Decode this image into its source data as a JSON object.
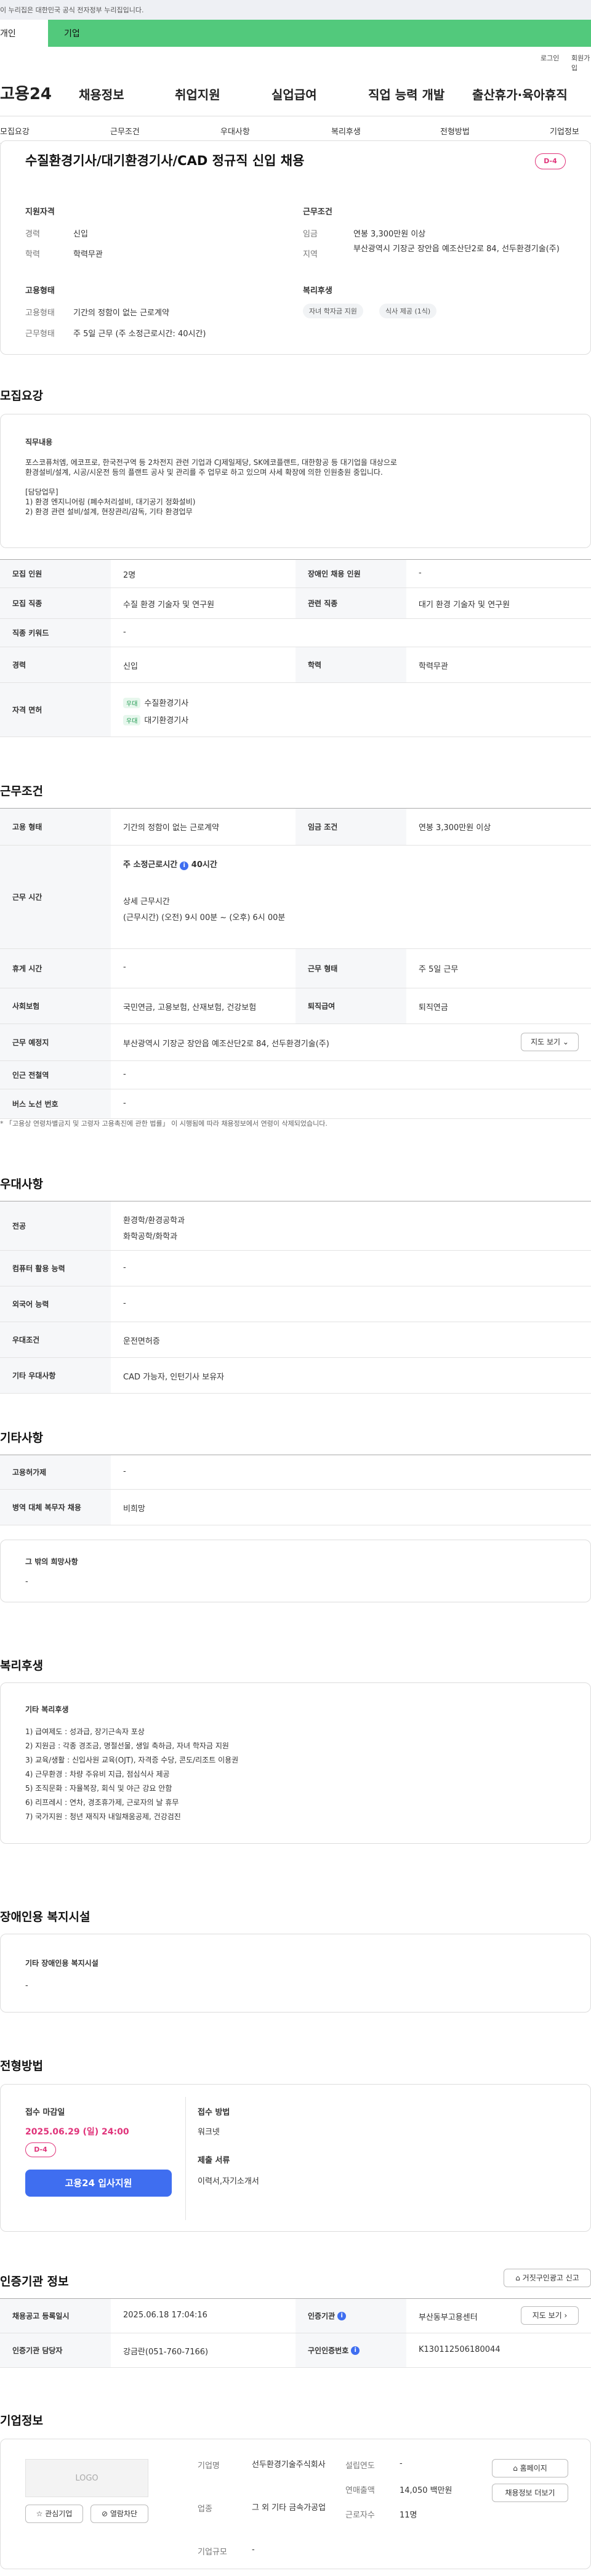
{
  "gov_banner": "이 누리집은 대한민국 공식 전자정부 누리집입니다.",
  "top_tabs": [
    "개인",
    "기업"
  ],
  "util_links": [
    "로그인",
    "회원가입"
  ],
  "logo": "고용24",
  "gnb": [
    "채용정보",
    "취업지원",
    "실업급여",
    "직업 능력 개발",
    "출산휴가·육아휴직"
  ],
  "sub_nav": [
    "모집요강",
    "근무조건",
    "우대사항",
    "복리후생",
    "전형방법",
    "기업정보"
  ],
  "job": {
    "title": "수질환경기사/대기환경기사/CAD 정규직 신입 채용",
    "dday": "D-4",
    "qual_heading": "지원자격",
    "career_label": "경력",
    "career": "신입",
    "edu_label": "학력",
    "edu": "학력무관",
    "cond_heading": "근무조건",
    "wage_label": "임금",
    "wage": "연봉 3,300만원 이상",
    "region_label": "지역",
    "region": "부산광역시 기장군 장안읍 예조산단2로 84, 선두환경기술(주)",
    "emp_heading": "고용형태",
    "emptype_label": "고용형태",
    "emptype": "기간의 정함이 없는 근로계약",
    "worktype_label": "근무형태",
    "worktype": "주 5일 근무 (주 소정근로시간: 40시간)",
    "welfare_heading": "복리후생",
    "welfare_chips": [
      "자녀 학자금 지원",
      "식사 제공 (1식)"
    ]
  },
  "recruit": {
    "heading": "모집요강",
    "duty_heading": "직무내용",
    "duty_lines": [
      "포스코퓨처엠, 에코프로, 한국전구역 등 2차전지 관련 기업과 CJ제일제당, SK에코플랜트, 대한항공 등 대기업을 대상으로",
      "환경설비/설계, 시공/시운전 등의 플랜트 공사 및 관리를 주 업무로 하고 있으며 사세 확장에 의한 인원충원 중입니다.",
      "",
      "[담당업무]",
      "1) 환경 엔지니어링 (폐수처리설비, 대기공기 정화설비)",
      "2) 환경 관련 설비/설계, 현장관리/감독, 기타 환경업무"
    ],
    "rows": {
      "headcount_label": "모집 인원",
      "headcount": "2명",
      "disabled_label": "장애인 채용 인원",
      "disabled": "-",
      "occ_label": "모집 직종",
      "occ": "수질 환경 기술자 및 연구원",
      "rel_label": "관련 직종",
      "rel": "대기 환경 기술자 및 연구원",
      "kw_label": "직종 키워드",
      "kw": "-",
      "career_label": "경력",
      "career": "신입",
      "edu_label": "학력",
      "edu": "학력무관",
      "lic_label": "자격 면허",
      "lic_tag": "우대",
      "lics": [
        "수질환경기사",
        "대기환경기사"
      ]
    }
  },
  "work": {
    "heading": "근무조건",
    "emp_label": "고용 형태",
    "emp": "기간의 정함이 없는 근로계약",
    "wage_label": "임금 조건",
    "wage": "연봉 3,300만원 이상",
    "time_label": "근무 시간",
    "weekly": "주 소정근로시간",
    "weekly_val": "40시간",
    "detail_title": "상세 근무시간",
    "detail": "(근무시간) (오전) 9시 00분 ~ (오후) 6시 00분",
    "holiday_label": "휴게 시간",
    "holiday": "-",
    "form_label": "근무 형태",
    "form": "주 5일 근무",
    "ins_label": "사회보험",
    "ins": "국민연금, 고용보험, 산재보험, 건강보험",
    "sev_label": "퇴직급여",
    "sev": "퇴직연금",
    "place_label": "근무 예정지",
    "place": "부산광역시 기장군 장안읍 예조산단2로 84, 선두환경기술(주)",
    "map_btn": "지도 보기",
    "subway_label": "인근 전철역",
    "subway": "-",
    "bus_label": "버스 노선 번호",
    "bus": "-",
    "note": "* 「고용상 연령차별금지 및 고령자 고용촉진에 관한 법률」 이 시행됨에 따라 채용정보에서 연령이 삭제되었습니다."
  },
  "pref": {
    "heading": "우대사항",
    "major_label": "전공",
    "majors": [
      "환경학/환경공학과",
      "화학공학/화학과"
    ],
    "pc_label": "컴퓨터 활용 능력",
    "pc": "-",
    "lang_label": "외국어 능력",
    "lang": "-",
    "cond_label": "우대조건",
    "cond": "운전면허증",
    "etc_label": "기타 우대사항",
    "etc": "CAD 가능자, 인턴기사 보유자"
  },
  "other": {
    "heading": "기타사항",
    "ins_label": "고용허가제",
    "ins": "-",
    "mil_label": "병역 대체 복무자 채용",
    "mil": "비희망",
    "etc_title": "그 밖의 희망사항",
    "etc": "-"
  },
  "welfare": {
    "heading": "복리후생",
    "title": "기타 복리후생",
    "lines": [
      "1) 급여제도 : 성과급, 장기근속자 포상",
      "2) 지원금 : 각종 경조금, 명절선물, 생일 축하금, 자녀 학자금 지원",
      "3) 교육/생활 : 신입사원 교육(OJT), 자격증 수당, 콘도/리조트 이용권",
      "4) 근무환경 : 차량 주유비 지급, 점심식사 제공",
      "5) 조직문화 : 자율복장, 회식 및 야근 강요 안함",
      "6) 리프레시 : 연차, 경조휴가제, 근로자의 날 휴무",
      "7) 국가지원 : 청년 재직자 내일채움공제, 건강검진"
    ]
  },
  "disabled_fac": {
    "heading": "장애인용 복지시설",
    "title": "기타 장애인용 복지시설",
    "val": "-"
  },
  "screen": {
    "heading": "전형방법",
    "deadline_label": "접수 마감일",
    "deadline": "2025.06.29 (일) 24:00",
    "dday": "D-4",
    "apply_btn": "고용24 입사지원",
    "method_label": "접수 방법",
    "method": "워크넷",
    "docs_label": "제출 서류",
    "docs": "이력서,자기소개서"
  },
  "agency": {
    "heading": "인증기관 정보",
    "report_btn": "거짓구인광고 신고",
    "reg_label": "채용공고 등록일시",
    "reg": "2025.06.18 17:04:16",
    "org_label": "인증기관",
    "org": "부산동부고용센터",
    "map_btn": "지도 보기",
    "staff_label": "인증기관 담당자",
    "staff": "강금란(051-760-7166)",
    "num_label": "구인인증번호",
    "num": "K130112506180044"
  },
  "company": {
    "heading": "기업정보",
    "logo": "LOGO",
    "fav_btn": "관심기업",
    "block_btn": "열람차단",
    "name_label": "기업명",
    "name": "선두환경기술주식회사",
    "ind_label": "업종",
    "ind": "그 외 기타 금속가공업",
    "scale_label": "기업규모",
    "scale": "-",
    "year_label": "설립연도",
    "year": "-",
    "sales_label": "연매출액",
    "sales": "14,050 백만원",
    "emp_label": "근로자수",
    "emp": "11명",
    "home_btn": "홈페이지",
    "more_btn": "채용정보 더보기"
  }
}
